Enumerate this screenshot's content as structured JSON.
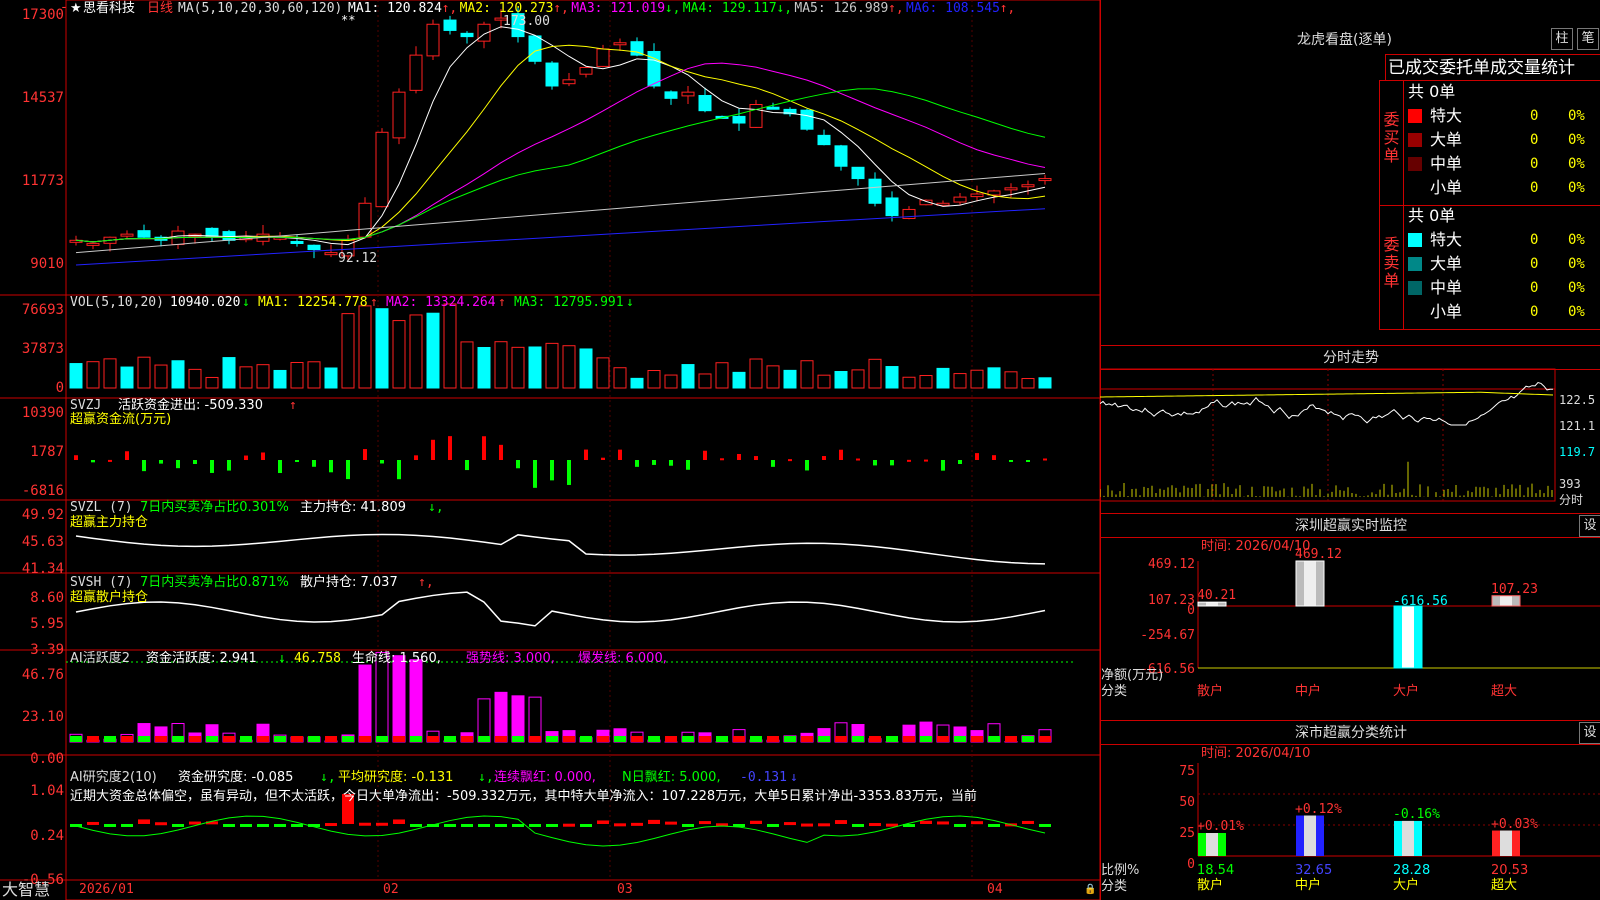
{
  "main": {
    "title_star": "★",
    "stock_name": "思看科技",
    "period": "日线",
    "ma_params": "MA(5,10,20,30,60,120)",
    "ma": [
      {
        "label": "MA1:",
        "value": "120.824",
        "arrow": "↑",
        "color": "#ffffff"
      },
      {
        "label": "MA2:",
        "value": "120.273",
        "arrow": "↑",
        "color": "#ffff00"
      },
      {
        "label": "MA3:",
        "value": "121.019",
        "arrow": "↓",
        "color": "#ff00ff"
      },
      {
        "label": "MA4:",
        "value": "129.117",
        "arrow": "↓",
        "color": "#00ff00"
      },
      {
        "label": "MA5:",
        "value": "126.989",
        "arrow": "↑",
        "color": "#c8c8c8"
      },
      {
        "label": "MA6:",
        "value": "108.545",
        "arrow": "↑",
        "color": "#2222ff"
      }
    ],
    "markers": "**",
    "high_label": "173.00",
    "low_label": "92.12",
    "axis_labels": [
      "17300",
      "14537",
      "11773",
      "9010"
    ]
  },
  "vol": {
    "title": "VOL(5,10,20)",
    "value": "10940.020",
    "value_arrow": "↓",
    "ma1": "MA1: 12254.778",
    "ma1_arrow": "↑",
    "ma2": "MA2: 13324.264",
    "ma2_arrow": "↑",
    "ma3": "MA3: 12795.991",
    "ma3_arrow": "↓",
    "axis_labels": [
      "76693",
      "37873",
      "0"
    ]
  },
  "svzj": {
    "title": "SVZJ",
    "line1": "活跃资金进出: -509.330",
    "line1_arrow": "↑",
    "line2": "超赢资金流(万元)",
    "axis_labels": [
      "10390",
      "1787",
      "-6816"
    ]
  },
  "svzl": {
    "title": "SVZL (7)",
    "text1": "7日内买卖净占比0.301%",
    "text2": "主力持仓: 41.809",
    "text2_arrow": "↓,",
    "line2": "超赢主力持仓",
    "axis_labels": [
      "49.92",
      "45.63",
      "41.34"
    ]
  },
  "svsh": {
    "title": "SVSH (7)",
    "text1": "7日内买卖净占比0.871%",
    "text2": "散户持仓: 7.037",
    "text2_arrow": "↑,",
    "line2": "超赢散户持仓",
    "axis_labels": [
      "8.60",
      "5.95",
      "3.39"
    ]
  },
  "ai_active": {
    "title": "AI活跃度2",
    "t1": "资金活跃度: 2.941",
    "t1_arrow": "↓",
    "t2": "46.758",
    "t3": "生命线: 1.560,",
    "t4": "强势线: 3.000,",
    "t5": "爆发线: 6.000,",
    "axis_labels": [
      "46.76",
      "23.10",
      "0.00"
    ]
  },
  "ai_research": {
    "title": "AI研究度2(10)",
    "t1": "资金研究度: -0.085",
    "t1_arrow": "↓,",
    "t2": "平均研究度: -0.131",
    "t2_arrow": "↓,",
    "t3": "连续飘红: 0.000,",
    "t4": "N日飘红: 5.000,",
    "t5": "-0.131",
    "t5_arrow": "↓",
    "summary": "近期大资金总体偏空，虽有异动，但不太活跃，今日大单净流出：-509.332万元，其中特大单净流入：107.228万元，大单5日累计净出-3353.83万元，当前",
    "axis_labels": [
      "1.04",
      "0.24",
      "-0.56"
    ]
  },
  "bottom": {
    "brand": "大智慧",
    "dates": [
      "2026/01",
      "02",
      "03",
      "04"
    ]
  },
  "dragon": {
    "header": "龙虎看盘(逐单)",
    "btn1": "柱",
    "btn2": "笔",
    "tab_title": "已成交委托单成交量统计",
    "buy_label": "委买单",
    "sell_label": "委卖单",
    "buy_total": "共 0单",
    "sell_total": "共 0单",
    "buy_rows": [
      {
        "name": "特大",
        "qty": "0",
        "pct": "0%",
        "color": "#ff0000"
      },
      {
        "name": "大单",
        "qty": "0",
        "pct": "0%",
        "color": "#990000"
      },
      {
        "name": "中单",
        "qty": "0",
        "pct": "0%",
        "color": "#660000"
      },
      {
        "name": "小单",
        "qty": "0",
        "pct": "0%",
        "color": ""
      }
    ],
    "sell_rows": [
      {
        "name": "特大",
        "qty": "0",
        "pct": "0%",
        "color": "#00ffff"
      },
      {
        "name": "大单",
        "qty": "0",
        "pct": "0%",
        "color": "#008888"
      },
      {
        "name": "中单",
        "qty": "0",
        "pct": "0%",
        "color": "#006666"
      },
      {
        "name": "小单",
        "qty": "0",
        "pct": "0%",
        "color": ""
      }
    ]
  },
  "intraday": {
    "header": "分时走势",
    "axis_labels": [
      "122.5",
      "121.1",
      "119.7",
      "393",
      "分时"
    ]
  },
  "sz_monitor": {
    "header": "深圳超赢实时监控",
    "btn": "设",
    "time": "时间: 2026/04/10",
    "axis_labels": [
      "469.12",
      "107.23",
      "0",
      "-254.67",
      "-616.56"
    ],
    "ylabel1": "净额(万元)",
    "ylabel2": "分类",
    "categories": [
      "散户",
      "中户",
      "大户",
      "超大"
    ],
    "values": [
      40.21,
      469.12,
      -616.56,
      107.23
    ],
    "value_labels": [
      "40.21",
      "469.12",
      "-616.56",
      "107.23"
    ]
  },
  "sh_stats": {
    "header": "深市超赢分类统计",
    "btn": "设",
    "time": "时间: 2026/04/10",
    "axis_labels": [
      "75",
      "50",
      "25",
      "0"
    ],
    "ylabel1": "比例%",
    "ylabel2": "分类",
    "categories": [
      "散户",
      "中户",
      "大户",
      "超大"
    ],
    "values": [
      18.54,
      32.65,
      28.28,
      20.53
    ],
    "value_labels": [
      "18.54",
      "32.65",
      "28.28",
      "20.53"
    ],
    "change_labels": [
      "+0.01%",
      "+0.12%",
      "-0.16%",
      "+0.03%"
    ]
  },
  "chart_data": {
    "type": "bar",
    "title": "深圳超赢实时监控",
    "categories": [
      "散户",
      "中户",
      "大户",
      "超大"
    ],
    "series": [
      {
        "name": "净额(万元)",
        "values": [
          40.21,
          469.12,
          -616.56,
          107.23
        ]
      }
    ],
    "ylabel": "净额(万元)",
    "ylim": [
      -616.56,
      469.12
    ]
  }
}
